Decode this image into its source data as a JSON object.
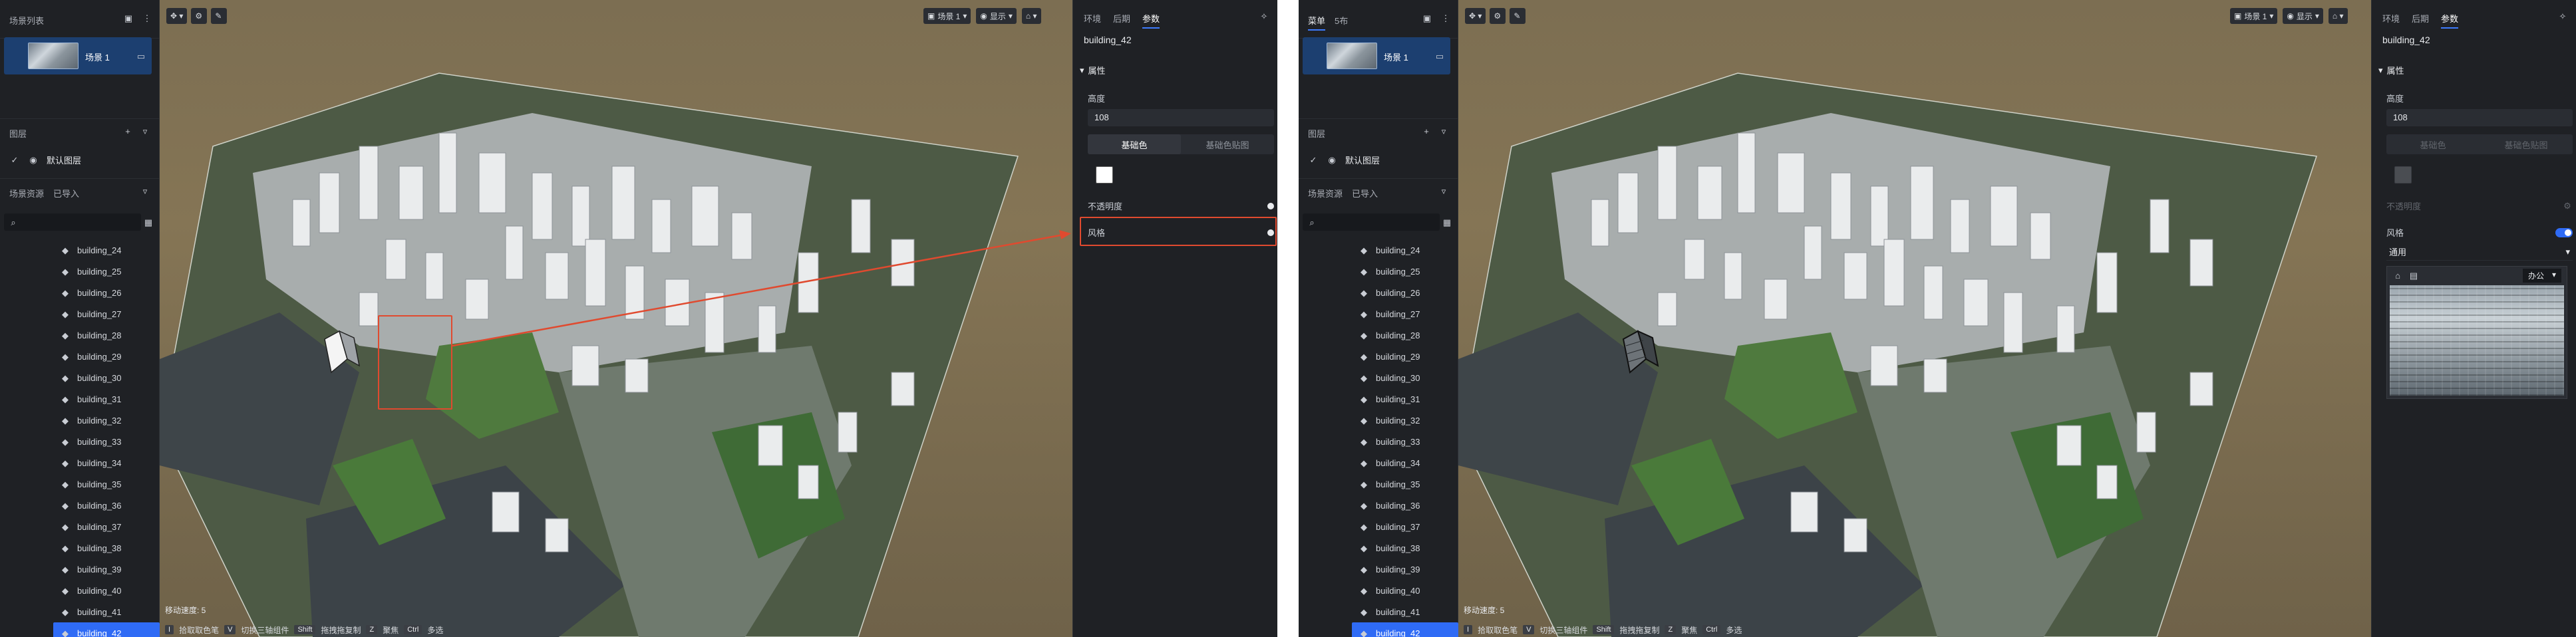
{
  "left_screen": {
    "lp": {
      "title": "场景列表",
      "scene_name": "场景 1",
      "layers_title": "图层",
      "layer_item": "默认图层",
      "resources_title": "场景资源",
      "resources_tab2": "已导入",
      "buildings": [
        "building_24",
        "building_25",
        "building_26",
        "building_27",
        "building_28",
        "building_29",
        "building_30",
        "building_31",
        "building_32",
        "building_33",
        "building_34",
        "building_35",
        "building_36",
        "building_37",
        "building_38",
        "building_39",
        "building_40",
        "building_41",
        "building_42"
      ]
    },
    "toolbar": {
      "scene_select": "场景 1",
      "display": "显示"
    },
    "status": {
      "speed": "移动速度: 5",
      "k1": "I",
      "h1": "拾取取色笔",
      "k2": "V",
      "h2": "切换三轴组件",
      "k3": "Shift",
      "h3": "拖拽拖复制",
      "k4": "Z",
      "h4": "聚焦",
      "k5": "Ctrl",
      "h5": "多选"
    },
    "rp": {
      "tabs": [
        "环境",
        "后期",
        "参数"
      ],
      "name": "building_42",
      "section": "属性",
      "height_label": "高度",
      "height_value": "108",
      "seg_color": "基础色",
      "seg_tex": "基础色贴图",
      "opacity": "不透明度",
      "style": "风格"
    }
  },
  "right_screen": {
    "lp": {
      "tabs": [
        "菜单",
        "5布"
      ],
      "scene_name": "场景 1",
      "layers_title": "图层",
      "layer_item": "默认图层",
      "resources_title": "场景资源",
      "resources_tab2": "已导入",
      "buildings": [
        "building_24",
        "building_25",
        "building_26",
        "building_27",
        "building_28",
        "building_29",
        "building_30",
        "building_31",
        "building_32",
        "building_33",
        "building_34",
        "building_35",
        "building_36",
        "building_37",
        "building_38",
        "building_39",
        "building_40",
        "building_41",
        "building_42"
      ]
    },
    "toolbar": {
      "scene_select": "场景 1",
      "display": "显示"
    },
    "status": {
      "speed": "移动速度: 5",
      "k1": "I",
      "h1": "拾取取色笔",
      "k2": "V",
      "h2": "切换三轴组件",
      "k3": "Shift",
      "h3": "拖拽拖复制",
      "k4": "Z",
      "h4": "聚焦",
      "k5": "Ctrl",
      "h5": "多选"
    },
    "rp": {
      "tabs": [
        "环境",
        "后期",
        "参数"
      ],
      "name": "building_42",
      "section": "属性",
      "height_label": "高度",
      "height_value": "108",
      "seg_color": "基础色",
      "seg_tex": "基础色贴图",
      "opacity": "不透明度",
      "style": "风格",
      "style_select": "通用",
      "tex_type": "办公"
    }
  },
  "colors": {
    "accent": "#2f6bf5",
    "annotation": "#e04a2f",
    "panel": "#1f2125"
  }
}
